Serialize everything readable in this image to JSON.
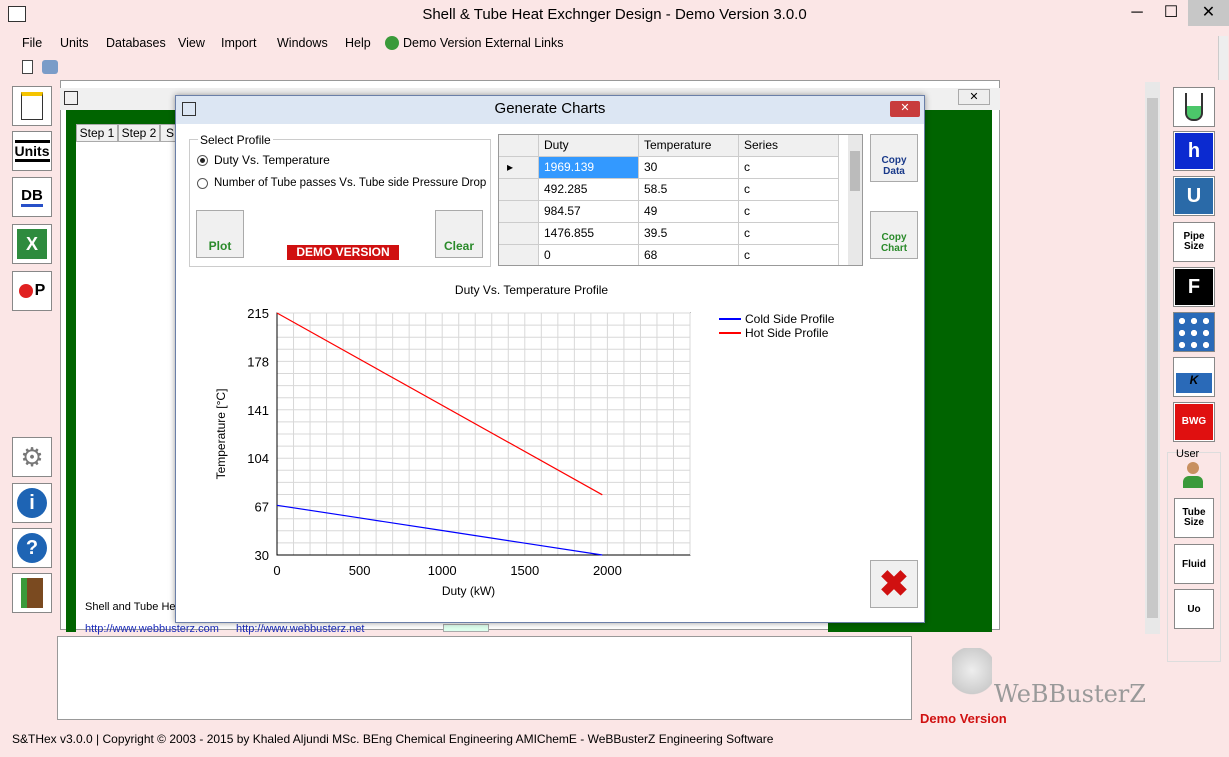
{
  "window": {
    "title": "Shell & Tube Heat Exchnger Design - Demo Version 3.0.0",
    "minimize": "─",
    "maximize": "☐",
    "close": "✕"
  },
  "menu": [
    "File",
    "Units",
    "Databases",
    "View",
    "Import",
    "Windows",
    "Help"
  ],
  "menu_links": "Demo Version External Links",
  "left_tools": [
    {
      "label": "",
      "icon": "new-document-icon"
    },
    {
      "label": "Units",
      "icon": "units-icon"
    },
    {
      "label": "DB",
      "icon": "database-icon"
    },
    {
      "label": "",
      "icon": "excel-icon"
    },
    {
      "label": "P",
      "icon": "pressure-icon"
    }
  ],
  "left_tools2": [
    {
      "icon": "gears-icon",
      "label": ""
    },
    {
      "icon": "info-icon",
      "label": "i"
    },
    {
      "icon": "help-icon",
      "label": "?"
    },
    {
      "icon": "exit-icon",
      "label": ""
    }
  ],
  "right_tools": [
    {
      "icon": "flask-icon",
      "label": ""
    },
    {
      "icon": "h-icon",
      "label": "h"
    },
    {
      "icon": "u-icon",
      "label": "U"
    },
    {
      "icon": "pipe-size-icon",
      "label": "Pipe Size"
    },
    {
      "icon": "f-icon",
      "label": "F"
    },
    {
      "icon": "tube-pattern-icon",
      "label": ""
    },
    {
      "icon": "k-icon",
      "label": "K"
    },
    {
      "icon": "bwg-icon",
      "label": "BWG"
    }
  ],
  "user_panel": {
    "label": "User",
    "buttons": [
      "Tube Size",
      "Fluid",
      "Uo"
    ]
  },
  "mdi": {
    "tabs": [
      "Step 1",
      "Step 2",
      "S"
    ],
    "footer_text": "Shell and Tube He",
    "link1": "http://www.webbusterz.com",
    "link2": "http://www.webbusterz.net"
  },
  "dialog": {
    "title": "Generate Charts",
    "group_title": "Select Profile",
    "radio1": "Duty Vs. Temperature",
    "radio2": "Number of Tube passes Vs. Tube side Pressure Drop",
    "plot_label": "Plot",
    "demo_label": "DEMO VERSION",
    "clear_label": "Clear",
    "copy_data_label": "Copy Data",
    "copy_chart_label": "Copy Chart",
    "grid_headers": [
      "Duty",
      "Temperature",
      "Series"
    ],
    "grid_rows": [
      [
        "1969.139",
        "30",
        "c"
      ],
      [
        "492.285",
        "58.5",
        "c"
      ],
      [
        "984.57",
        "49",
        "c"
      ],
      [
        "1476.855",
        "39.5",
        "c"
      ],
      [
        "0",
        "68",
        "c"
      ]
    ]
  },
  "chart_data": {
    "type": "line",
    "title": "Duty Vs. Temperature Profile",
    "xlabel": "Duty (kW)",
    "ylabel": "Temperature [°C]",
    "xlim": [
      0,
      2500
    ],
    "ylim": [
      30,
      215
    ],
    "xticks": [
      0,
      500,
      1000,
      1500,
      2000
    ],
    "yticks": [
      30,
      67,
      104,
      141,
      178,
      215
    ],
    "grid": true,
    "legend": "top-right",
    "series": [
      {
        "name": "Cold Side Profile",
        "color": "#0000ff",
        "x": [
          0,
          492.285,
          984.57,
          1476.855,
          1969.139
        ],
        "y": [
          68,
          58.5,
          49,
          39.5,
          30
        ]
      },
      {
        "name": "Hot Side Profile",
        "color": "#ff0000",
        "x": [
          0,
          1969.139
        ],
        "y": [
          215,
          76
        ]
      }
    ]
  },
  "brand": {
    "name": "WeBBusterZ",
    "tag": "Demo Version"
  },
  "status": "S&THex  v3.0.0  |  Copyright © 2003 - 2015 by Khaled Aljundi MSc. BEng Chemical Engineering AMIChemE - WeBBusterZ Engineering Software"
}
